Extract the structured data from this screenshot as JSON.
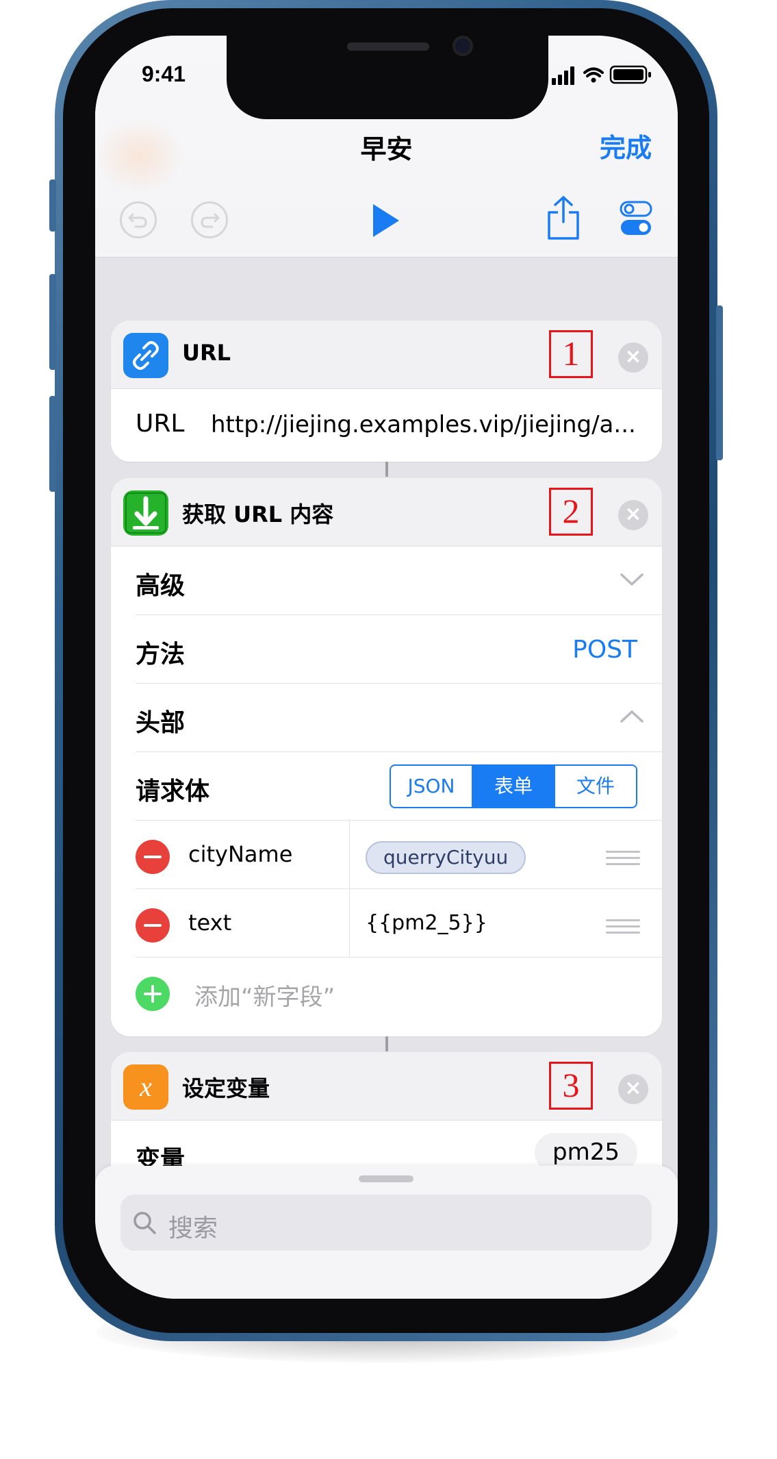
{
  "status": {
    "time": "9:41"
  },
  "nav": {
    "title": "早安",
    "done_label": "完成"
  },
  "cards": {
    "url": {
      "title": "URL",
      "badge": "1",
      "field_label": "URL",
      "field_value": "http://jiejing.examples.vip/jiejing/a..."
    },
    "fetch": {
      "title": "获取 URL 内容",
      "badge": "2",
      "advanced_label": "高级",
      "method_label": "方法",
      "method_value": "POST",
      "headers_label": "头部",
      "body_label": "请求体",
      "body_options": [
        "JSON",
        "表单",
        "文件"
      ],
      "body_selected": "表单",
      "fields": [
        {
          "key": "cityName",
          "value": "querryCityuu",
          "is_variable": true
        },
        {
          "key": "text",
          "value": "{{pm2_5}}",
          "is_variable": false
        }
      ],
      "add_field_label": "添加“新字段”"
    },
    "setvar": {
      "title": "设定变量",
      "badge": "3",
      "var_label": "变量",
      "var_value": "pm25"
    }
  },
  "search": {
    "placeholder": "搜索"
  },
  "colors": {
    "accent": "#1a7cf2",
    "annotation": "#e8141a",
    "url_icon": "#1f86ee",
    "fetch_icon": "#27b22c",
    "setvar_icon": "#f7921e"
  }
}
